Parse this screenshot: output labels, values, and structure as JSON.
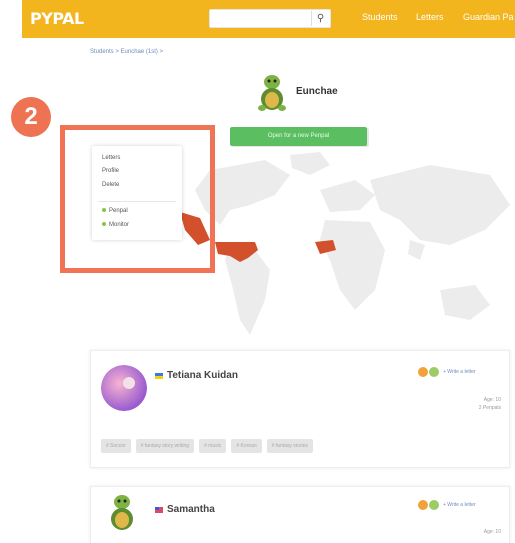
{
  "header": {
    "logo": "PYPAL",
    "search_icon": "search-icon",
    "nav": [
      "Students",
      "Letters",
      "Guardian Pa"
    ]
  },
  "breadcrumb": "Students > Eunchae (1st) >",
  "profile": {
    "name": "Eunchae",
    "open_button": "Open for a new Penpal"
  },
  "menu": {
    "items": [
      "Letters",
      "Profile",
      "Delete"
    ],
    "toggles": [
      "Penpal",
      "Monitor"
    ]
  },
  "step_badge": "2",
  "colors": {
    "accent": "#f2b51e",
    "highlight": "#f07356",
    "button": "#5bbf61",
    "map_marker": "#d3502c"
  },
  "cards": [
    {
      "name": "Tetiana Kuidan",
      "write_link": "+ Write a letter",
      "age": "Age: 10",
      "penpals": "2 Penpals",
      "tags": [
        "# Soccer",
        "# fantasy story writing",
        "# music",
        "# Korean",
        "# fantasy stories"
      ]
    },
    {
      "name": "Samantha",
      "write_link": "+ Write a letter",
      "age": "Age: 10"
    }
  ]
}
